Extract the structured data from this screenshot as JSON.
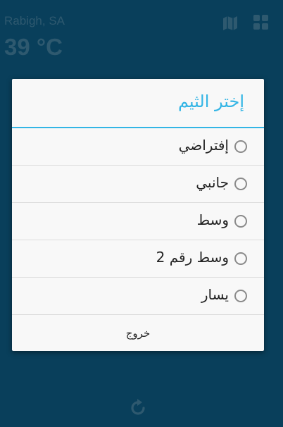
{
  "header": {
    "city": "Rabigh, SA",
    "temperature": "39 °C",
    "map_icon": "map-icon",
    "themes_icon": "grid-icon"
  },
  "dialog": {
    "title": "إختر الثيم",
    "options": [
      {
        "label": "إفتراضي",
        "selected": false
      },
      {
        "label": "جانبي",
        "selected": false
      },
      {
        "label": "وسط",
        "selected": false
      },
      {
        "label": "وسط رقم 2",
        "selected": false
      },
      {
        "label": "يسار",
        "selected": false
      }
    ],
    "exit_label": "خروج"
  },
  "footer": {
    "refresh_icon": "refresh-icon"
  },
  "colors": {
    "background": "#0e4c6c",
    "muted_text": "#47738b",
    "accent": "#33b5e5",
    "dialog_bg": "#f8f8f8"
  }
}
